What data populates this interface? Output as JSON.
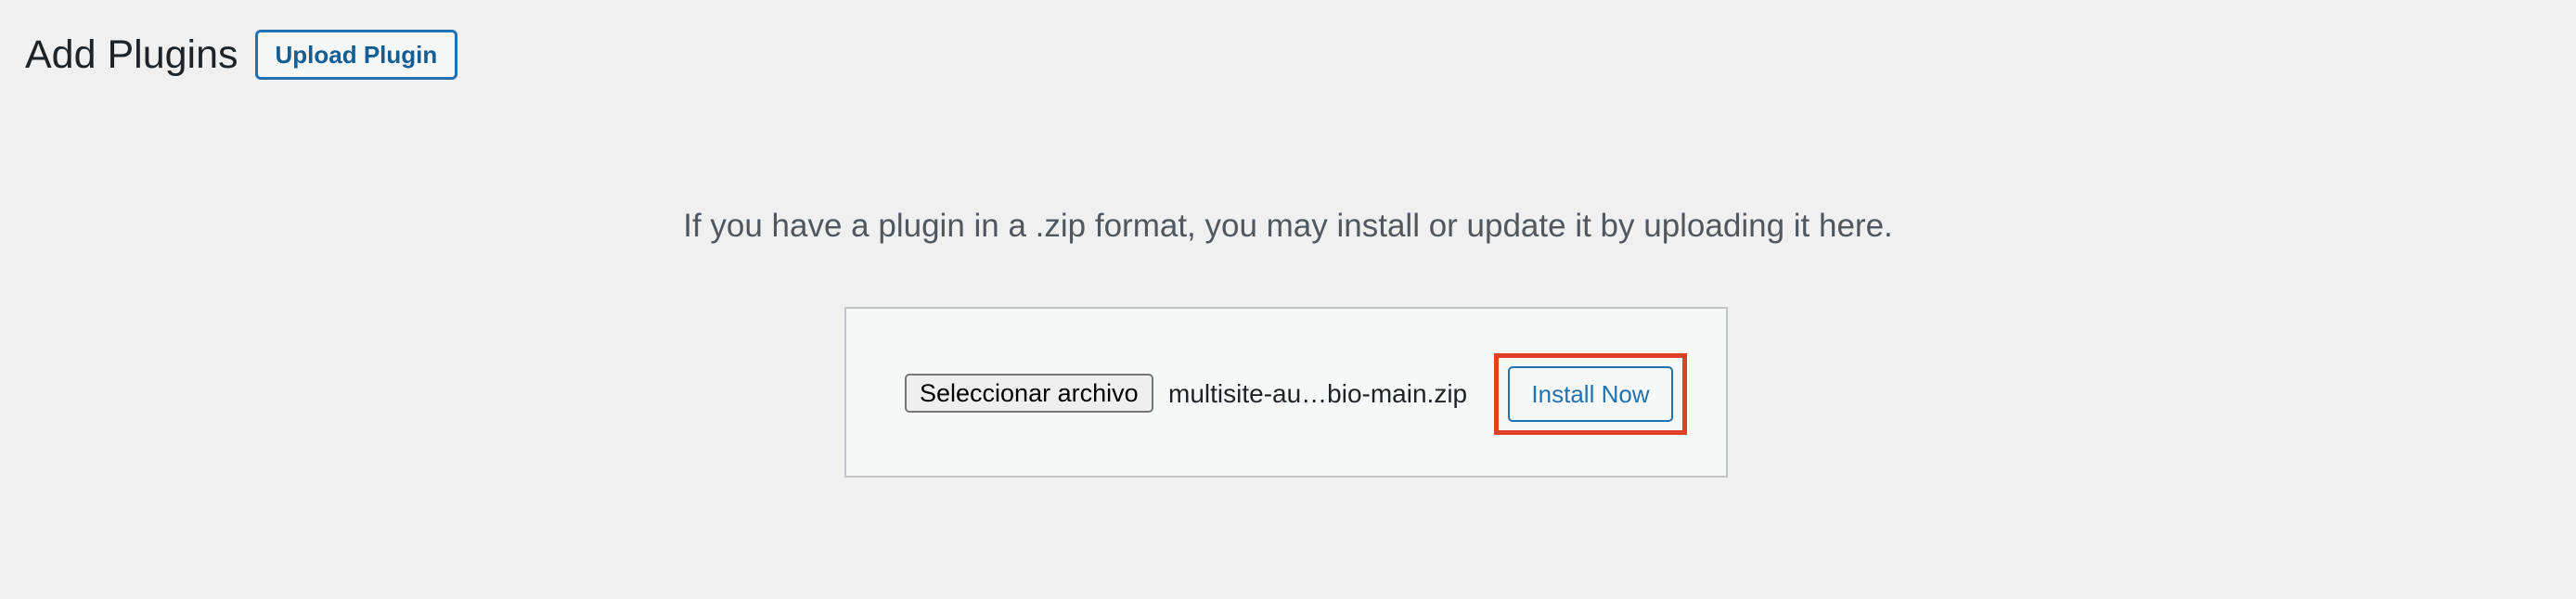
{
  "header": {
    "title": "Add Plugins",
    "upload_button_label": "Upload Plugin"
  },
  "upload_form": {
    "help_text": "If you have a plugin in a .zip format, you may install or update it by uploading it here.",
    "file_button_label": "Seleccionar archivo",
    "selected_file_name": "multisite-au…bio-main.zip",
    "install_button_label": "Install Now"
  },
  "colors": {
    "background": "#f0f0f1",
    "accent": "#2271b1",
    "highlight": "#e23f27"
  }
}
